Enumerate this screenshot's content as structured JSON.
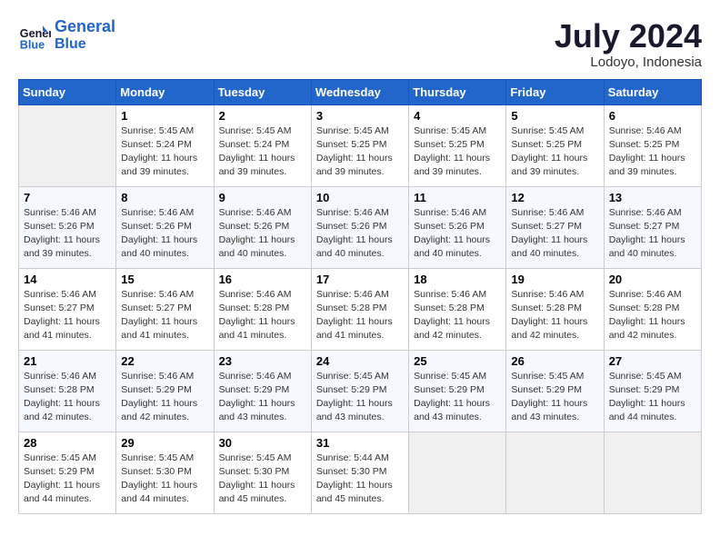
{
  "header": {
    "logo_line1": "General",
    "logo_line2": "Blue",
    "month": "July 2024",
    "location": "Lodoyo, Indonesia"
  },
  "weekdays": [
    "Sunday",
    "Monday",
    "Tuesday",
    "Wednesday",
    "Thursday",
    "Friday",
    "Saturday"
  ],
  "weeks": [
    [
      {
        "num": "",
        "info": ""
      },
      {
        "num": "1",
        "info": "Sunrise: 5:45 AM\nSunset: 5:24 PM\nDaylight: 11 hours\nand 39 minutes."
      },
      {
        "num": "2",
        "info": "Sunrise: 5:45 AM\nSunset: 5:24 PM\nDaylight: 11 hours\nand 39 minutes."
      },
      {
        "num": "3",
        "info": "Sunrise: 5:45 AM\nSunset: 5:25 PM\nDaylight: 11 hours\nand 39 minutes."
      },
      {
        "num": "4",
        "info": "Sunrise: 5:45 AM\nSunset: 5:25 PM\nDaylight: 11 hours\nand 39 minutes."
      },
      {
        "num": "5",
        "info": "Sunrise: 5:45 AM\nSunset: 5:25 PM\nDaylight: 11 hours\nand 39 minutes."
      },
      {
        "num": "6",
        "info": "Sunrise: 5:46 AM\nSunset: 5:25 PM\nDaylight: 11 hours\nand 39 minutes."
      }
    ],
    [
      {
        "num": "7",
        "info": "Sunrise: 5:46 AM\nSunset: 5:26 PM\nDaylight: 11 hours\nand 39 minutes."
      },
      {
        "num": "8",
        "info": "Sunrise: 5:46 AM\nSunset: 5:26 PM\nDaylight: 11 hours\nand 40 minutes."
      },
      {
        "num": "9",
        "info": "Sunrise: 5:46 AM\nSunset: 5:26 PM\nDaylight: 11 hours\nand 40 minutes."
      },
      {
        "num": "10",
        "info": "Sunrise: 5:46 AM\nSunset: 5:26 PM\nDaylight: 11 hours\nand 40 minutes."
      },
      {
        "num": "11",
        "info": "Sunrise: 5:46 AM\nSunset: 5:26 PM\nDaylight: 11 hours\nand 40 minutes."
      },
      {
        "num": "12",
        "info": "Sunrise: 5:46 AM\nSunset: 5:27 PM\nDaylight: 11 hours\nand 40 minutes."
      },
      {
        "num": "13",
        "info": "Sunrise: 5:46 AM\nSunset: 5:27 PM\nDaylight: 11 hours\nand 40 minutes."
      }
    ],
    [
      {
        "num": "14",
        "info": "Sunrise: 5:46 AM\nSunset: 5:27 PM\nDaylight: 11 hours\nand 41 minutes."
      },
      {
        "num": "15",
        "info": "Sunrise: 5:46 AM\nSunset: 5:27 PM\nDaylight: 11 hours\nand 41 minutes."
      },
      {
        "num": "16",
        "info": "Sunrise: 5:46 AM\nSunset: 5:28 PM\nDaylight: 11 hours\nand 41 minutes."
      },
      {
        "num": "17",
        "info": "Sunrise: 5:46 AM\nSunset: 5:28 PM\nDaylight: 11 hours\nand 41 minutes."
      },
      {
        "num": "18",
        "info": "Sunrise: 5:46 AM\nSunset: 5:28 PM\nDaylight: 11 hours\nand 42 minutes."
      },
      {
        "num": "19",
        "info": "Sunrise: 5:46 AM\nSunset: 5:28 PM\nDaylight: 11 hours\nand 42 minutes."
      },
      {
        "num": "20",
        "info": "Sunrise: 5:46 AM\nSunset: 5:28 PM\nDaylight: 11 hours\nand 42 minutes."
      }
    ],
    [
      {
        "num": "21",
        "info": "Sunrise: 5:46 AM\nSunset: 5:28 PM\nDaylight: 11 hours\nand 42 minutes."
      },
      {
        "num": "22",
        "info": "Sunrise: 5:46 AM\nSunset: 5:29 PM\nDaylight: 11 hours\nand 42 minutes."
      },
      {
        "num": "23",
        "info": "Sunrise: 5:46 AM\nSunset: 5:29 PM\nDaylight: 11 hours\nand 43 minutes."
      },
      {
        "num": "24",
        "info": "Sunrise: 5:45 AM\nSunset: 5:29 PM\nDaylight: 11 hours\nand 43 minutes."
      },
      {
        "num": "25",
        "info": "Sunrise: 5:45 AM\nSunset: 5:29 PM\nDaylight: 11 hours\nand 43 minutes."
      },
      {
        "num": "26",
        "info": "Sunrise: 5:45 AM\nSunset: 5:29 PM\nDaylight: 11 hours\nand 43 minutes."
      },
      {
        "num": "27",
        "info": "Sunrise: 5:45 AM\nSunset: 5:29 PM\nDaylight: 11 hours\nand 44 minutes."
      }
    ],
    [
      {
        "num": "28",
        "info": "Sunrise: 5:45 AM\nSunset: 5:29 PM\nDaylight: 11 hours\nand 44 minutes."
      },
      {
        "num": "29",
        "info": "Sunrise: 5:45 AM\nSunset: 5:30 PM\nDaylight: 11 hours\nand 44 minutes."
      },
      {
        "num": "30",
        "info": "Sunrise: 5:45 AM\nSunset: 5:30 PM\nDaylight: 11 hours\nand 45 minutes."
      },
      {
        "num": "31",
        "info": "Sunrise: 5:44 AM\nSunset: 5:30 PM\nDaylight: 11 hours\nand 45 minutes."
      },
      {
        "num": "",
        "info": ""
      },
      {
        "num": "",
        "info": ""
      },
      {
        "num": "",
        "info": ""
      }
    ]
  ]
}
